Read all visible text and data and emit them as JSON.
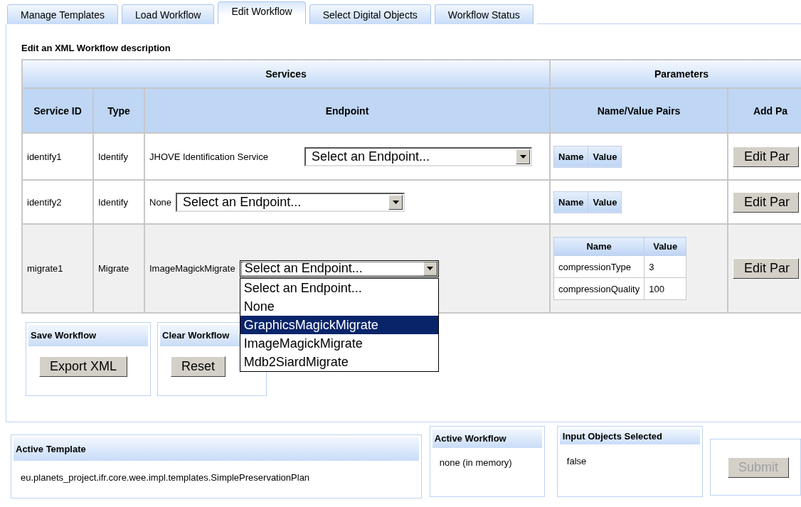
{
  "tabs": [
    {
      "label": "Manage Templates",
      "selected": false
    },
    {
      "label": "Load Workflow",
      "selected": false
    },
    {
      "label": "Edit Workflow",
      "selected": true
    },
    {
      "label": "Select Digital Objects",
      "selected": false
    },
    {
      "label": "Workflow Status",
      "selected": false
    }
  ],
  "heading": "Edit an XML Workflow description",
  "table": {
    "group_headers": [
      "Services",
      "Parameters"
    ],
    "columns": [
      "Service ID",
      "Type",
      "Endpoint",
      "Name/Value Pairs",
      "Add Pa"
    ],
    "rows": [
      {
        "service_id": "identify1",
        "type": "Identify",
        "endpoint": "JHOVE Identification Service",
        "select": "Select an Endpoint...",
        "focused": false,
        "param_columns": [
          "Name",
          "Value"
        ],
        "params": [],
        "button": "Edit Par"
      },
      {
        "service_id": "identify2",
        "type": "Identify",
        "endpoint": "None",
        "select": "Select an Endpoint...",
        "focused": false,
        "param_columns": [
          "Name",
          "Value"
        ],
        "params": [],
        "button": "Edit Par"
      },
      {
        "service_id": "migrate1",
        "type": "Migrate",
        "endpoint": "ImageMagickMigrate",
        "select": "Select an Endpoint...",
        "focused": true,
        "param_columns": [
          "Name",
          "Value"
        ],
        "params": [
          {
            "name": "compressionType",
            "value": "3"
          },
          {
            "name": "compressionQuality",
            "value": "100"
          }
        ],
        "button": "Edit Par",
        "options": [
          {
            "label": "Select an Endpoint...",
            "selected": false
          },
          {
            "label": "None",
            "selected": false
          },
          {
            "label": "GraphicsMagickMigrate",
            "selected": true
          },
          {
            "label": "ImageMagickMigrate",
            "selected": false
          },
          {
            "label": "Mdb2SiardMigrate",
            "selected": false
          }
        ]
      }
    ]
  },
  "actions": [
    {
      "title": "Save Workflow",
      "button": "Export XML"
    },
    {
      "title": "Clear Workflow",
      "button": "Reset"
    }
  ],
  "status": {
    "active_template": {
      "title": "Active Template",
      "value": "eu.planets_project.ifr.core.wee.impl.templates.SimplePreservationPlan"
    },
    "active_workflow": {
      "title": "Active Workflow",
      "value": "none (in memory)"
    },
    "input_objects": {
      "title": "Input Objects Selected",
      "value": "false"
    },
    "submit": {
      "label": "Submit",
      "disabled": true
    }
  }
}
